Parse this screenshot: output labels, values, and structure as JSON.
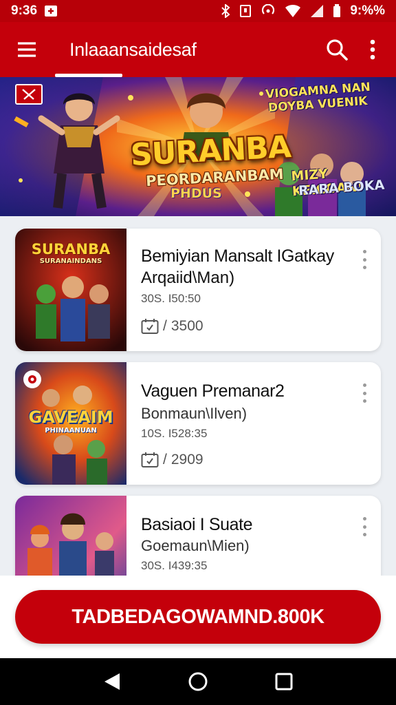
{
  "status_bar": {
    "time": "9:36",
    "battery": "9:%%",
    "icons": [
      "media-icon",
      "bluetooth-icon",
      "nfc-icon",
      "hotspot-icon",
      "wifi-icon",
      "signal-icon",
      "battery-icon"
    ]
  },
  "app_bar": {
    "title": "Inlaaansaidesaf",
    "icons": [
      "menu-icon",
      "search-icon",
      "more-vert-icon"
    ]
  },
  "banner": {
    "title": "SURANBA",
    "subtitle": "PEORDARANBAM",
    "tag": "PHDUS",
    "right_top_line1": "VIOGAMNA NAN",
    "right_top_line2": "DOYBA VUENIK",
    "right_bottom_line1": "MIZY KFICOAN!",
    "right_bottom_line2": "RARA BOKA"
  },
  "games": [
    {
      "title": "Bemiyian Mansalt IGatkay",
      "subtitle": "Arqaiid\\Man)",
      "meta": "30S. I50:50",
      "count": "3500",
      "thumb_title": "SURANBA",
      "thumb_subtitle": "SURANAINDANS"
    },
    {
      "title": "Vaguen Premanar2",
      "subtitle": "Bonmaun\\Ilven)",
      "meta": "10S. I528:35",
      "count": "2909",
      "thumb_title": "GAVEAIM",
      "thumb_subtitle": "PHINAANUAN"
    },
    {
      "title": "Basiaoi I Suate",
      "subtitle": "Goemaun\\Mien)",
      "meta": "30S. I439:35",
      "count": "",
      "thumb_title": "",
      "thumb_subtitle": ""
    }
  ],
  "cta": {
    "label": "TADBEDAGOWAMND.800K"
  },
  "nav_bar": {
    "icons": [
      "back-icon",
      "home-icon",
      "recents-icon"
    ]
  },
  "colors": {
    "primary": "#c4000b",
    "status_bar": "#b70008",
    "background": "#eceff3",
    "card": "#ffffff",
    "nav_bar": "#000000"
  }
}
